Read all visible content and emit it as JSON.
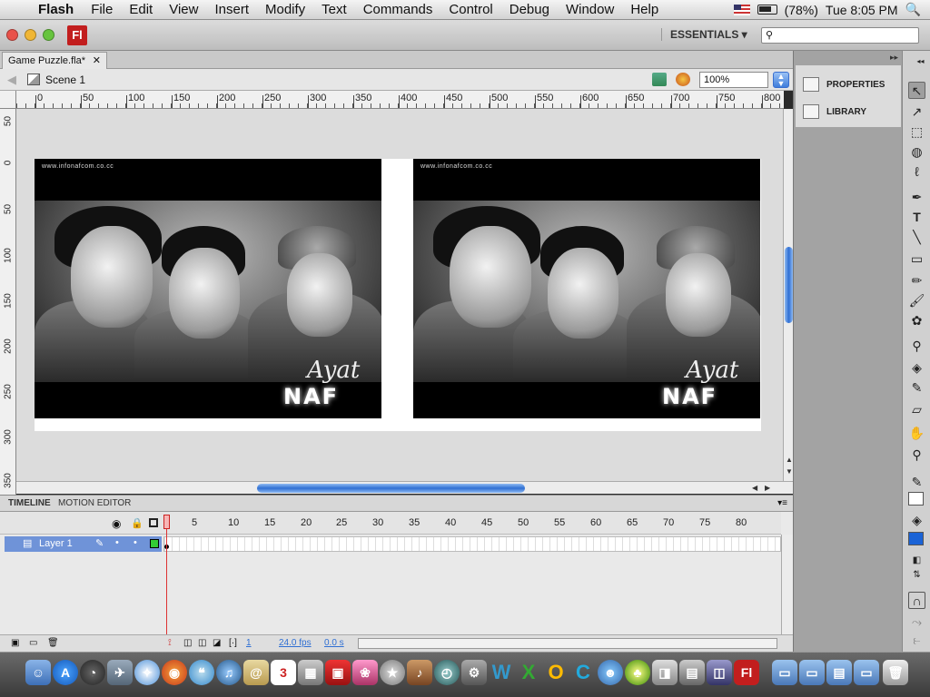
{
  "menubar": {
    "app_name": "Flash",
    "items": [
      "File",
      "Edit",
      "View",
      "Insert",
      "Modify",
      "Text",
      "Commands",
      "Control",
      "Debug",
      "Window",
      "Help"
    ],
    "battery": "(78%)",
    "clock": "Tue 8:05 PM"
  },
  "titlebar": {
    "app_badge": "Fl",
    "workspace": "ESSENTIALS ▾",
    "search_placeholder": ""
  },
  "document_tab": {
    "label": "Game Puzzle.fla*",
    "close": "✕"
  },
  "editbar": {
    "scene": "Scene 1",
    "zoom": "100%"
  },
  "rulers": {
    "horizontal": [
      "0",
      "50",
      "100",
      "150",
      "200",
      "250",
      "300",
      "350",
      "400",
      "450",
      "500",
      "550",
      "600",
      "650",
      "700",
      "750",
      "800"
    ],
    "vertical": [
      "50",
      "0",
      "50",
      "100",
      "150",
      "200",
      "250",
      "300",
      "350"
    ]
  },
  "stage": {
    "photos": [
      {
        "url_text": "www.infonafcom.co.cc",
        "brand": "NAF",
        "signature": "Ayat"
      },
      {
        "url_text": "www.infonafcom.co.cc",
        "brand": "NAF",
        "signature": "Ayat"
      }
    ]
  },
  "timeline": {
    "tabs": [
      "TIMELINE",
      "MOTION EDITOR"
    ],
    "frame_numbers": [
      "1",
      "5",
      "10",
      "15",
      "20",
      "25",
      "30",
      "35",
      "40",
      "45",
      "50",
      "55",
      "60",
      "65",
      "70",
      "75",
      "80"
    ],
    "layer_name": "Layer 1",
    "current_frame": "1",
    "fps": "24.0 fps",
    "time": "0.0 s"
  },
  "panels": {
    "properties": "PROPERTIES",
    "library": "LIBRARY"
  },
  "colors": {
    "accent": "#2f6fd3",
    "layer_highlight": "#6f93d8",
    "fl_badge": "#c21e1e",
    "stage_bg": "#dcdcdc"
  }
}
